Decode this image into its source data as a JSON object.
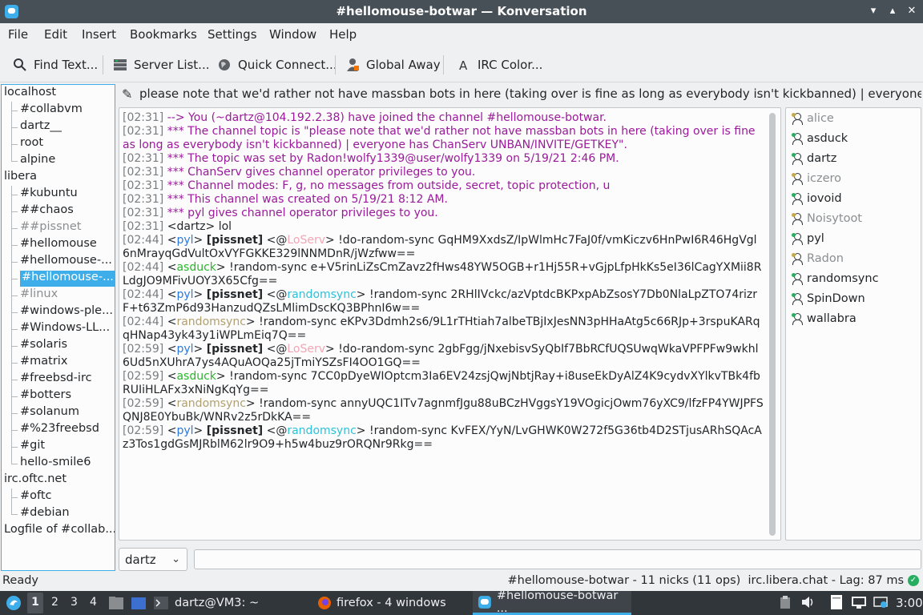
{
  "window": {
    "title": "#hellomouse-botwar — Konversation"
  },
  "menu": [
    "File",
    "Edit",
    "Insert",
    "Bookmarks",
    "Settings",
    "Window",
    "Help"
  ],
  "toolbar": {
    "find_text": "Find Text...",
    "server_list": "Server List...",
    "quick_connect": "Quick Connect...",
    "global_away": "Global Away",
    "irc_color": "IRC Color..."
  },
  "tree": [
    {
      "label": "localhost",
      "type": "server"
    },
    {
      "label": "#collabvm",
      "type": "chan"
    },
    {
      "label": "dartz__",
      "type": "chan"
    },
    {
      "label": "root",
      "type": "chan"
    },
    {
      "label": "alpine",
      "type": "chan"
    },
    {
      "label": "libera",
      "type": "server"
    },
    {
      "label": "#kubuntu",
      "type": "chan"
    },
    {
      "label": "##chaos",
      "type": "chan"
    },
    {
      "label": "##pissnet",
      "type": "chan",
      "dim": true
    },
    {
      "label": "#hellomouse",
      "type": "chan"
    },
    {
      "label": "#hellomouse-...",
      "type": "chan"
    },
    {
      "label": "#hellomouse-...",
      "type": "chan",
      "selected": true
    },
    {
      "label": "#linux",
      "type": "chan",
      "dim": true
    },
    {
      "label": "#windows-ple...",
      "type": "chan"
    },
    {
      "label": "#Windows-LL...",
      "type": "chan"
    },
    {
      "label": "#solaris",
      "type": "chan"
    },
    {
      "label": "#matrix",
      "type": "chan"
    },
    {
      "label": "#freebsd-irc",
      "type": "chan"
    },
    {
      "label": "#botters",
      "type": "chan"
    },
    {
      "label": "#solanum",
      "type": "chan"
    },
    {
      "label": "#%23freebsd",
      "type": "chan"
    },
    {
      "label": "#git",
      "type": "chan"
    },
    {
      "label": "hello-smile6",
      "type": "chan"
    },
    {
      "label": "irc.oftc.net",
      "type": "server"
    },
    {
      "label": "#oftc",
      "type": "chan"
    },
    {
      "label": "#debian",
      "type": "chan"
    },
    {
      "label": "Logfile of #collab...",
      "type": "server"
    }
  ],
  "topic": "please note that we'd rather not have massban bots in here (taking over is fine as long as everybody isn't kickbanned) | everyone has ChanSe...",
  "chat": [
    {
      "ts": "[02:31]",
      "kind": "sys",
      "text": " --> You (~dartz@104.192.2.38) have joined the channel #hellomouse-botwar."
    },
    {
      "ts": "[02:31]",
      "kind": "sys",
      "text": " *** The channel topic is \"please note that we'd rather not have massban bots in here (taking over is fine as long as everybody isn't kickbanned) | everyone has ChanServ UNBAN/INVITE/GETKEY\"."
    },
    {
      "ts": "[02:31]",
      "kind": "sys",
      "text": " *** The topic was set by Radon!wolfy1339@user/wolfy1339 on 5/19/21 2:46 PM."
    },
    {
      "ts": "[02:31]",
      "kind": "sys",
      "text": " *** ChanServ gives channel operator privileges to you."
    },
    {
      "ts": "[02:31]",
      "kind": "sys",
      "text": " *** Channel modes: F, g, no messages from outside, secret, topic protection, u"
    },
    {
      "ts": "[02:31]",
      "kind": "sys",
      "text": " *** This channel was created on 5/19/21 8:12 AM."
    },
    {
      "ts": "[02:31]",
      "kind": "sys",
      "text": " *** pyl gives channel operator privileges to you."
    },
    {
      "ts": "[02:31]",
      "kind": "msg",
      "nick": "dartz",
      "color": "#232629",
      "pre": "",
      "text": " lol"
    },
    {
      "ts": "[02:44]",
      "kind": "msg",
      "nick": "pyl",
      "color": "#2a7ae2",
      "pre": " [pissnet] <@",
      "nick2": "LoServ",
      "color2": "#f3a6b4",
      "text": "> !do-random-sync GqHM9XxdsZ/IpWlmHc7FaJ0f/vmKiczv6HnPwI6R46HgVgl6nMrayqGdVultOxVYFGKKE329lNNMDnR/jWzfww=="
    },
    {
      "ts": "[02:44]",
      "kind": "msg",
      "nick": "asduck",
      "color": "#2cb52c",
      "pre": "",
      "text": " !random-sync e+V5rinLiZsCmZavz2fHws48YW5OGB+r1Hj55R+vGjpLfpHkKs5eI36lCagYXMii8RLdgJO9MFivUOY3X65Cfg=="
    },
    {
      "ts": "[02:44]",
      "kind": "msg",
      "nick": "pyl",
      "color": "#2a7ae2",
      "pre": " [pissnet] <@",
      "nick2": "randomsync",
      "color2": "#30c0d8",
      "text": "> !random-sync 2RHlIVckc/azVptdcBKPxpAbZsosY7Db0NlaLpZTO74rizrF+t63ZmP6d93HanzudQZsLMlimDscKQ3BPhnI6w=="
    },
    {
      "ts": "[02:44]",
      "kind": "msg",
      "nick": "randomsync",
      "color": "#b0a070",
      "pre": "",
      "text": " !random-sync eKPv3Ddmh2s6/9L1rTHtiah7albeTBjIxJesNN3pHHaAtg5c66RJp+3rspuKARqqHNap43yk43y1iWPLmEiq7Q=="
    },
    {
      "ts": "[02:59]",
      "kind": "msg",
      "nick": "pyl",
      "color": "#2a7ae2",
      "pre": " [pissnet] <@",
      "nick2": "LoServ",
      "color2": "#f3a6b4",
      "text": "> !do-random-sync 2gbFgg/jNxebisvSyQbIf7BbRCfUQSUwqWkaVPFPFw9wkhl6Ud5nXUhrA7ys4AQuAOQa25jTmiYSZsFI4OO1GQ=="
    },
    {
      "ts": "[02:59]",
      "kind": "msg",
      "nick": "asduck",
      "color": "#2cb52c",
      "pre": "",
      "text": " !random-sync 7CC0pDyeWIOptcm3Ia6EV24zsjQwjNbtjRay+i8useEkDyAlZ4K9cydvXYlkvTBk4fbRUIiHLAFx3xNiNgKqYg=="
    },
    {
      "ts": "[02:59]",
      "kind": "msg",
      "nick": "randomsync",
      "color": "#b0a070",
      "pre": "",
      "text": " !random-sync annyUQC1ITv7agnmfJgu88uBCzHVggsY19VOgicjOwm76yXC9/lfzFP4YWJPFSQNJ8E0YbuBk/WNRv2z5rDkKA=="
    },
    {
      "ts": "[02:59]",
      "kind": "msg",
      "nick": "pyl",
      "color": "#2a7ae2",
      "pre": " [pissnet] <@",
      "nick2": "randomsync",
      "color2": "#30c0d8",
      "text": "> !random-sync KvFEX/YyN/LvGHWK0W272f5G36tb4D2STjusARhSQAcAz3Tos1gdGsMJRblM62lr9O9+h5w4buz9rORQNr9Rkg=="
    }
  ],
  "nicks": [
    {
      "name": "alice",
      "away": true
    },
    {
      "name": "asduck",
      "away": false
    },
    {
      "name": "dartz",
      "away": false
    },
    {
      "name": "iczero",
      "away": true
    },
    {
      "name": "iovoid",
      "away": false
    },
    {
      "name": "Noisytoot",
      "away": true
    },
    {
      "name": "pyl",
      "away": false
    },
    {
      "name": "Radon",
      "away": true
    },
    {
      "name": "randomsync",
      "away": false
    },
    {
      "name": "SpinDown",
      "away": false
    },
    {
      "name": "wallabra",
      "away": false
    }
  ],
  "input": {
    "nick": "dartz"
  },
  "status": {
    "left": "Ready",
    "right": "#hellomouse-botwar - 11 nicks (11 ops)  irc.libera.chat - Lag: 87 ms"
  },
  "taskbar": {
    "desktops": [
      "1",
      "2",
      "3",
      "4"
    ],
    "terminal": "dartz@VM3: ~",
    "firefox": "firefox - 4 windows",
    "konversation": "#hellomouse-botwar ...",
    "clock": "3:00"
  }
}
